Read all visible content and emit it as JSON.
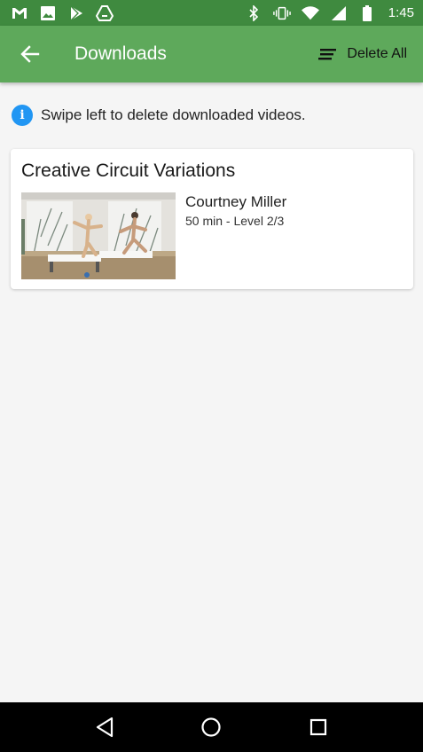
{
  "status_bar": {
    "time": "1:45",
    "icons_left": [
      "gmail-icon",
      "photos-icon",
      "play-store-icon",
      "drive-icon"
    ],
    "icons_right": [
      "bluetooth-icon",
      "vibrate-icon",
      "wifi-icon",
      "signal-icon",
      "battery-icon"
    ]
  },
  "app_bar": {
    "title": "Downloads",
    "delete_all_label": "Delete All",
    "background": "#5ea95b"
  },
  "info": {
    "text": "Swipe left to delete downloaded videos.",
    "icon": "i",
    "color": "#2196f3"
  },
  "downloads": [
    {
      "title": "Creative Circuit Variations",
      "instructor": "Courtney Miller",
      "meta": "50 min - Level 2/3"
    }
  ]
}
